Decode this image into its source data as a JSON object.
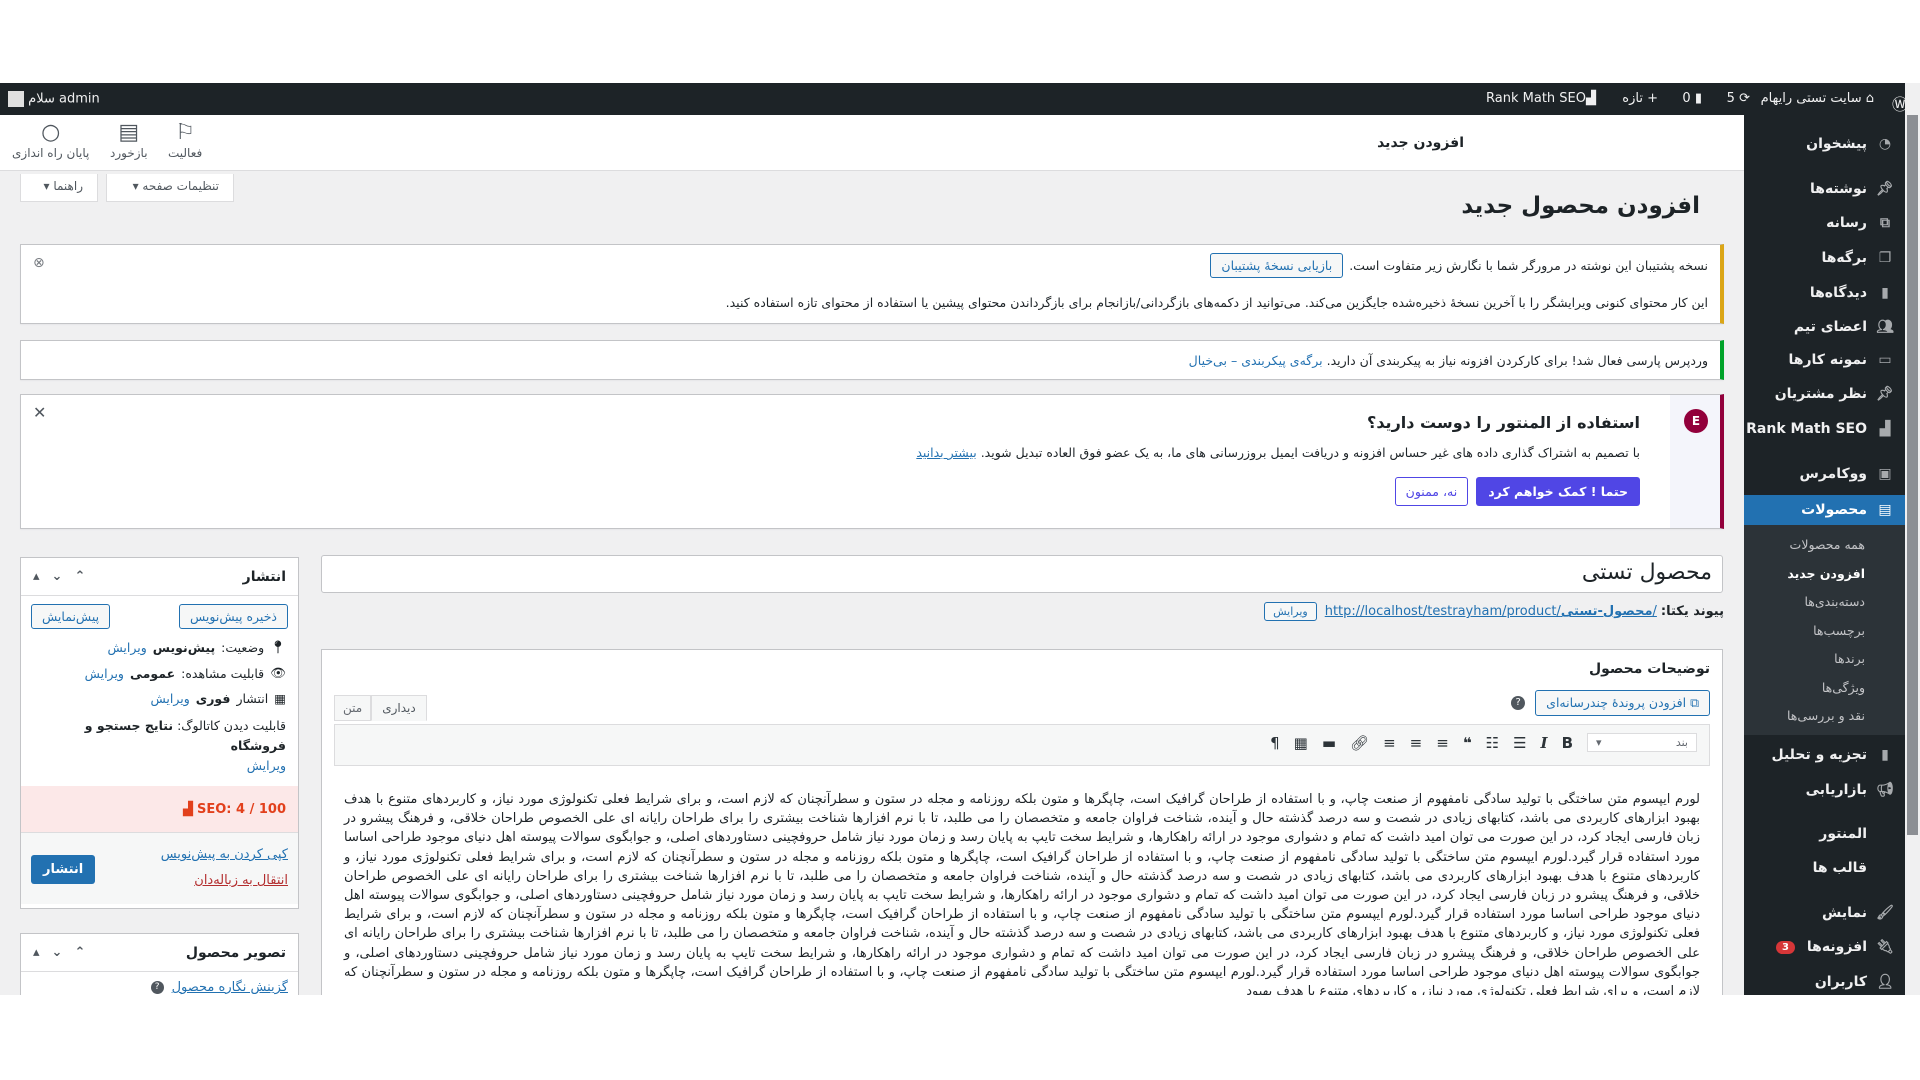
{
  "adminbar": {
    "site_name": "سایت تستی رایهام",
    "updates": "5",
    "comments": "0",
    "new": "تازه",
    "rankmath": "Rank Math SEO",
    "greeting": "سلام admin"
  },
  "header": {
    "title": "افزودن جدید",
    "actions": [
      {
        "label": "فعالیت"
      },
      {
        "label": "بازخورد"
      },
      {
        "label": "پایان راه اندازی"
      }
    ],
    "screen_options": "تنظیمات صفحه",
    "help": "راهنما"
  },
  "page_title": "افزودن محصول جدید",
  "notices": {
    "backup": {
      "text": "نسخه پشتیبان این نوشته در مرورگر شما با نگارش زیر متفاوت است.",
      "button": "بازیابی نسخهٔ پشتیبان",
      "detail": "این کار محتوای کنونی ویرایشگر را با آخرین نسخهٔ ذخیره‌شده جایگزین می‌کند. می‌توانید از دکمه‌های بازگردانی/بازانجام برای بازگرداندن محتوای پیشین یا استفاده از محتوای تازه استفاده کنید."
    },
    "parsi": {
      "text": "وردپرس پارسی فعال شد! برای کارکردن افزونه نیاز به پیکربندی آن دارید.",
      "link1": "برگه‌ی پیکربندی",
      "sep": "–",
      "link2": "بی‌خیال"
    },
    "elementor": {
      "title": "استفاده از المنتور را دوست دارید؟",
      "text": "با تصمیم به اشتراک گذاری داده های غیر حساس افزونه و دریافت ایمیل بروزرسانی های ما، به یک عضو فوق العاده تبدیل شوید.",
      "learn_more": "بیشتر بدانید",
      "accept": "حتما ! کمک خواهم کرد",
      "decline": "نه، ممنون",
      "accent": "#92003b",
      "button_color": "#5046e5"
    }
  },
  "product": {
    "title": "محصول تستی",
    "permalink_label": "پیوند یکتا:",
    "permalink_base": "http://localhost/testrayham/product/",
    "permalink_slug": "محصول-تستی",
    "permalink_end": "/",
    "edit": "ویرایش"
  },
  "editor": {
    "heading": "توضیحات محصول",
    "add_media": "افزودن پروندهٔ چندرسانه‌ای",
    "tab_visual": "دیداری",
    "tab_text": "متن",
    "format": "بند",
    "content": "لورم ایپسوم متن ساختگی با تولید سادگی نامفهوم از صنعت چاپ، و با استفاده از طراحان گرافیک است، چاپگرها و متون بلکه روزنامه و مجله در ستون و سطرآنچنان که لازم است، و برای شرایط فعلی تکنولوژی مورد نیاز، و کاربردهای متنوع با هدف بهبود ابزارهای کاربردی می باشد، کتابهای زیادی در شصت و سه درصد گذشته حال و آینده، شناخت فراوان جامعه و متخصصان را می طلبد، تا با نرم افزارها شناخت بیشتری را برای طراحان رایانه ای علی الخصوص طراحان خلاقی، و فرهنگ پیشرو در زبان فارسی ایجاد کرد، در این صورت می توان امید داشت که تمام و دشواری موجود در ارائه راهکارها، و شرایط سخت تایپ به پایان رسد و زمان مورد نیاز شامل حروفچینی دستاوردهای اصلی، و جوابگوی سوالات پیوسته اهل دنیای موجود طراحی اساسا مورد استفاده قرار گیرد.لورم ایپسوم متن ساختگی با تولید سادگی نامفهوم از صنعت چاپ، و با استفاده از طراحان گرافیک است، چاپگرها و متون بلکه روزنامه و مجله در ستون و سطرآنچنان که لازم است، و برای شرایط فعلی تکنولوژی مورد نیاز، و کاربردهای متنوع با هدف بهبود ابزارهای کاربردی می باشد، کتابهای زیادی در شصت و سه درصد گذشته حال و آینده، شناخت فراوان جامعه و متخصصان را می طلبد، تا با نرم افزارها شناخت بیشتری را برای طراحان رایانه ای علی الخصوص طراحان خلاقی، و فرهنگ پیشرو در زبان فارسی ایجاد کرد، در این صورت می توان امید داشت که تمام و دشواری موجود در ارائه راهکارها، و شرایط سخت تایپ به پایان رسد و زمان مورد نیاز شامل حروفچینی دستاوردهای اصلی، و جوابگوی سوالات پیوسته اهل دنیای موجود طراحی اساسا مورد استفاده قرار گیرد.لورم ایپسوم متن ساختگی با تولید سادگی نامفهوم از صنعت چاپ، و با استفاده از طراحان گرافیک است، چاپگرها و متون بلکه روزنامه و مجله در ستون و سطرآنچنان که لازم است، و برای شرایط فعلی تکنولوژی مورد نیاز، و کاربردهای متنوع با هدف بهبود ابزارهای کاربردی می باشد، کتابهای زیادی در شصت و سه درصد گذشته حال و آینده، شناخت فراوان جامعه و متخصصان را می طلبد، تا با نرم افزارها شناخت بیشتری را برای طراحان رایانه ای علی الخصوص طراحان خلاقی، و فرهنگ پیشرو در زبان فارسی ایجاد کرد، در این صورت می توان امید داشت که تمام و دشواری موجود در ارائه راهکارها، و شرایط سخت تایپ به پایان رسد و زمان مورد نیاز شامل حروفچینی دستاوردهای اصلی، و جوابگوی سوالات پیوسته اهل دنیای موجود طراحی اساسا مورد استفاده قرار گیرد.لورم ایپسوم متن ساختگی با تولید سادگی نامفهوم از صنعت چاپ، و با استفاده از طراحان گرافیک است، چاپگرها و متون بلکه روزنامه و مجله در ستون و سطرآنچنان که لازم است، و برای شرایط فعلی تکنولوژی مورد نیاز، و کاربردهای متنوع با هدف بهبود"
  },
  "publish": {
    "title": "انتشار",
    "save_draft": "ذخیره پیش‌نویس",
    "preview": "پیش‌نمایش",
    "status_label": "وضعیت:",
    "status": "پیش‌نویس",
    "visibility_label": "قابلیت مشاهده:",
    "visibility": "عمومی",
    "publish_label": "انتشار",
    "publish_when": "فوری",
    "catalog_label": "قابلیت دیدن کاتالوگ:",
    "catalog": "نتایج جستجو و فروشگاه",
    "edit": "ویرایش",
    "seo": "SEO: 4 / 100",
    "copy_draft": "کپی کردن به پیش‌نویس",
    "trash": "انتقال به زباله‌دان",
    "publish_button": "انتشار"
  },
  "product_image": {
    "title": "تصویر محصول",
    "set_link": "گزینش نگاره محصول"
  },
  "menu": {
    "items": [
      {
        "label": "پیشخوان",
        "icon": "dashboard-icon"
      },
      {
        "label": "نوشته‌ها",
        "icon": "pin-icon"
      },
      {
        "label": "رسانه",
        "icon": "media-icon"
      },
      {
        "label": "برگه‌ها",
        "icon": "pages-icon"
      },
      {
        "label": "دیدگاه‌ها",
        "icon": "comment-icon"
      },
      {
        "label": "اعضای تیم",
        "icon": "team-icon"
      },
      {
        "label": "نمونه کارها",
        "icon": "folder-icon"
      },
      {
        "label": "نظر مشتریان",
        "icon": "pin-icon"
      },
      {
        "label": "Rank Math SEO",
        "icon": "rankmath-icon"
      },
      {
        "label": "ووکامرس",
        "icon": "woo-icon"
      },
      {
        "label": "محصولات",
        "icon": "archive-icon"
      },
      {
        "label": "تجزیه و تحلیل",
        "icon": "chart-icon"
      },
      {
        "label": "بازاریابی",
        "icon": "megaphone-icon"
      },
      {
        "label": "المنتور",
        "icon": ""
      },
      {
        "label": "قالب ها",
        "icon": ""
      },
      {
        "label": "نمایش",
        "icon": "brush-icon"
      },
      {
        "label": "افزونه‌ها",
        "icon": "plugin-icon",
        "badge": "3"
      },
      {
        "label": "کاربران",
        "icon": "user-icon"
      }
    ],
    "submenu": [
      "همه محصولات",
      "افزودن جدید",
      "دسته‌بندی‌ها",
      "برچسب‌ها",
      "برندها",
      "ویژگی‌ها",
      "نقد و بررسی‌ها"
    ]
  }
}
